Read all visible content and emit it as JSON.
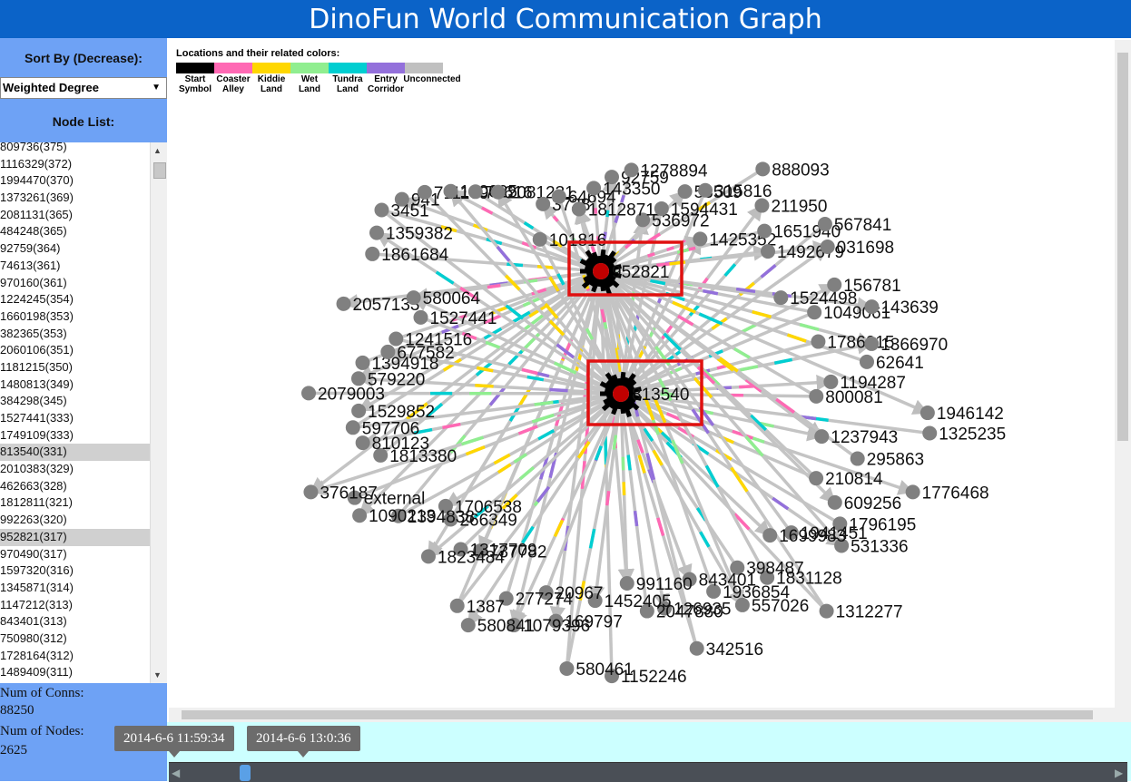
{
  "header": {
    "title": "DinoFun World Communication Graph"
  },
  "sidebar": {
    "sort_label": "Sort By (Decrease):",
    "sort_value": "Weighted Degree",
    "node_list_label": "Node List:",
    "nodes": [
      "809736(375)",
      "1116329(372)",
      "1994470(370)",
      "1373261(369)",
      "2081131(365)",
      "484248(365)",
      "92759(364)",
      "74613(361)",
      "970160(361)",
      "1224245(354)",
      "1660198(353)",
      "382365(353)",
      "2060106(351)",
      "1181215(350)",
      "1480813(349)",
      "384298(345)",
      "1527441(333)",
      "1749109(333)",
      "813540(331)",
      "2010383(329)",
      "462663(328)",
      "1812811(321)",
      "992263(320)",
      "952821(317)",
      "970490(317)",
      "1597320(316)",
      "1345871(314)",
      "1147212(313)",
      "843401(313)",
      "750980(312)",
      "1728164(312)",
      "1489409(311)"
    ],
    "selected": [
      "813540(331)",
      "952821(317)"
    ],
    "conns_label": "Num of Conns:",
    "conns_value": "88250",
    "nodes_label": "Num of Nodes:",
    "nodes_value": "2625"
  },
  "legend": {
    "title": "Locations and their related colors:",
    "items": [
      {
        "label_1": "Start",
        "label_2": "Symbol",
        "color": "#000000"
      },
      {
        "label_1": "Coaster",
        "label_2": "Alley",
        "color": "#ff69b4"
      },
      {
        "label_1": "Kiddie",
        "label_2": "Land",
        "color": "#ffd700"
      },
      {
        "label_1": "Wet",
        "label_2": "Land",
        "color": "#90ee90"
      },
      {
        "label_1": "Tundra",
        "label_2": "Land",
        "color": "#00ced1"
      },
      {
        "label_1": "Entry",
        "label_2": "Corridor",
        "color": "#9370db"
      },
      {
        "label_1": "Unconnected",
        "label_2": "",
        "color": "#c0c0c0"
      }
    ]
  },
  "graph": {
    "hubs": [
      "952821",
      "813540"
    ],
    "nodes": [
      "92759",
      "1278894",
      "536972",
      "1594431",
      "53509",
      "315816",
      "1425352",
      "888093",
      "211950",
      "1651940",
      "1492679",
      "567841",
      "031698",
      "1524498",
      "156781",
      "1049061",
      "143639",
      "1786015",
      "1366970",
      "62641",
      "1194287",
      "800081",
      "1946142",
      "1325235",
      "1237943",
      "295863",
      "1776468",
      "210814",
      "609256",
      "1796195",
      "531336",
      "1941451",
      "1699983",
      "1312277",
      "1831128",
      "398487",
      "557026",
      "1936854",
      "843401",
      "342516",
      "126935",
      "2047880",
      "991160",
      "1152246",
      "1452405",
      "580461",
      "169797",
      "20967",
      "1079396",
      "277274",
      "580841",
      "1387",
      "737782",
      "1317709",
      "1823484",
      "266349",
      "1706538",
      "1394838",
      "1090213",
      "external",
      "376187",
      "1813380",
      "810123",
      "597706",
      "1529852",
      "2079003",
      "579220",
      "1394918",
      "677582",
      "1241516",
      "2057133",
      "1527441",
      "580064",
      "1861684",
      "1359382",
      "3451",
      "941",
      "711179",
      "140025",
      "74616",
      "2081231",
      "101816",
      "3738",
      "64694",
      "1812871",
      "143350"
    ]
  },
  "timeline": {
    "start": "2014-6-6 11:59:34",
    "end": "2014-6-6 13:0:36",
    "progress": 0.08
  }
}
